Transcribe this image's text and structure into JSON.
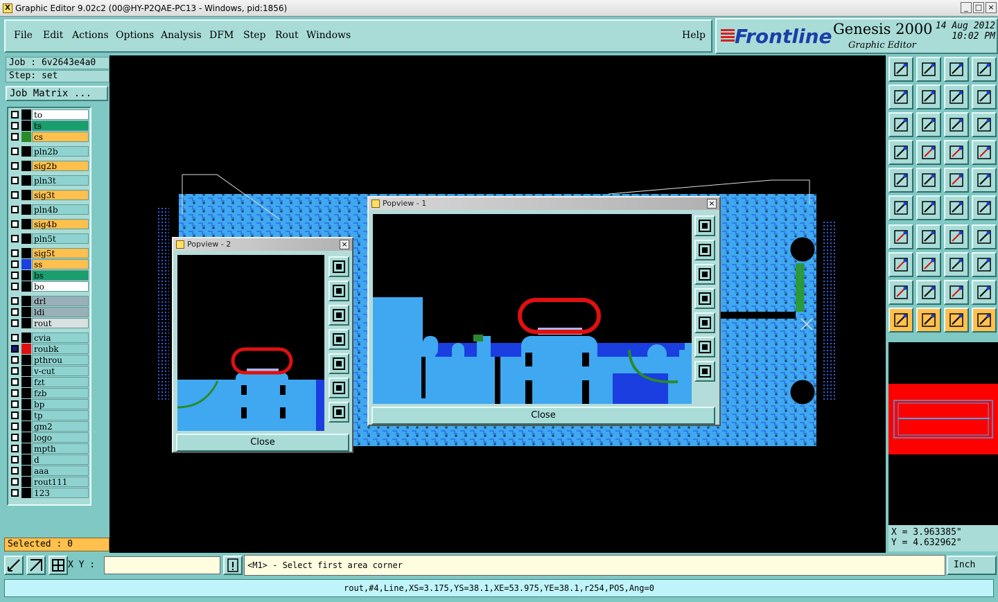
{
  "window": {
    "title": "Graphic Editor 9.02c2 (00@HY-P2QAE-PC13 - Windows, pid:1856)"
  },
  "menu": {
    "items": [
      "File",
      "Edit",
      "Actions",
      "Options",
      "Analysis",
      "DFM",
      "Step",
      "Rout",
      "Windows"
    ],
    "help": "Help"
  },
  "brand": {
    "logo": "Frontline",
    "product": "Genesis 2000",
    "subtitle": "Graphic Editor",
    "date": "14 Aug 2012",
    "time": "10:02 PM"
  },
  "job": {
    "label": "Job : 6v2643e4a0",
    "step": "Step: set",
    "matrix_button": "Job Matrix ..."
  },
  "layers": [
    {
      "name": "to",
      "color": "#ffffff"
    },
    {
      "name": "ts",
      "color": "#1a9e6e"
    },
    {
      "name": "cs",
      "color": "#ffc04d",
      "swatch": "#2a8a2a"
    },
    {
      "name": "pln2b",
      "color": "#8fd3d0"
    },
    {
      "name": "sig2b",
      "color": "#ffc04d"
    },
    {
      "name": "pln3t",
      "color": "#8fd3d0"
    },
    {
      "name": "sig3t",
      "color": "#ffc04d"
    },
    {
      "name": "pln4b",
      "color": "#8fd3d0"
    },
    {
      "name": "sig4b",
      "color": "#ffc04d"
    },
    {
      "name": "pln5t",
      "color": "#8fd3d0"
    },
    {
      "name": "sig5t",
      "color": "#ffc04d"
    },
    {
      "name": "ss",
      "color": "#ffc04d",
      "swatch": "#1a3ee0"
    },
    {
      "name": "bs",
      "color": "#1a9e6e"
    },
    {
      "name": "bo",
      "color": "#ffffff"
    },
    {
      "name": "drl",
      "color": "#9ab0b8"
    },
    {
      "name": "ldi",
      "color": "#9ab0b8"
    },
    {
      "name": "rout",
      "color": "#d8e0e0"
    },
    {
      "name": "cvia",
      "color": "#8fd3d0"
    },
    {
      "name": "roubk",
      "color": "#8fd3d0",
      "swatch": "#e01010",
      "active": true
    },
    {
      "name": "pthrou",
      "color": "#8fd3d0"
    },
    {
      "name": "v-cut",
      "color": "#8fd3d0"
    },
    {
      "name": "fzt",
      "color": "#8fd3d0"
    },
    {
      "name": "fzb",
      "color": "#8fd3d0"
    },
    {
      "name": "bp",
      "color": "#8fd3d0"
    },
    {
      "name": "tp",
      "color": "#8fd3d0"
    },
    {
      "name": "gm2",
      "color": "#8fd3d0"
    },
    {
      "name": "logo",
      "color": "#8fd3d0"
    },
    {
      "name": "mpth",
      "color": "#8fd3d0"
    },
    {
      "name": "d",
      "color": "#8fd3d0"
    },
    {
      "name": "aaa",
      "color": "#8fd3d0"
    },
    {
      "name": "rout111",
      "color": "#8fd3d0"
    },
    {
      "name": "123",
      "color": "#8fd3d0"
    }
  ],
  "selected": "Selected : 0",
  "popups": [
    {
      "title": "Popview - 2",
      "close_label": "Close"
    },
    {
      "title": "Popview - 1",
      "close_label": "Close"
    }
  ],
  "coords": {
    "x": "X = 3.963385\"",
    "y": "Y = 4.632962\""
  },
  "bottom": {
    "xy_label": "X Y :",
    "prompt": "<M1> - Select first area corner",
    "unit": "Inch"
  },
  "status": "rout,#4,Line,XS=3.175,YS=38.1,XE=53.975,YE=38.1,r254,POS,Ang=0",
  "colors": {
    "panel": "#7fc8c4",
    "board": "#3fa8f0",
    "trace": "#1a3ee0",
    "rout": "#e01010"
  }
}
